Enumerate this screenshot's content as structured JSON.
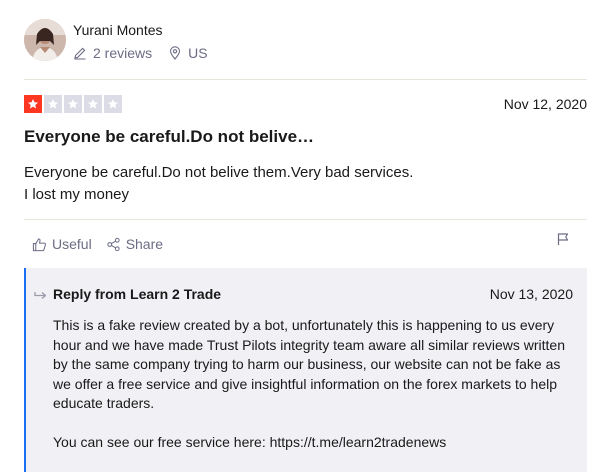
{
  "reviewer": {
    "name": "Yurani Montes",
    "reviews_count": "2 reviews",
    "country": "US"
  },
  "review": {
    "rating": 1,
    "max_rating": 5,
    "date": "Nov 12, 2020",
    "title": "Everyone be careful.Do not belive…",
    "body_lines": [
      "Everyone be careful.Do not belive them.Very bad services.",
      "I lost my money"
    ]
  },
  "actions": {
    "useful_label": "Useful",
    "share_label": "Share"
  },
  "reply": {
    "header": "Reply from Learn 2 Trade",
    "date": "Nov 13, 2020",
    "paragraphs": [
      "This is a fake review created by a bot, unfortunately this is happening to us every hour and we have made Trust Pilots integrity team aware all similar reviews written by the same company trying to harm our business, our website can not be fake as we offer a free service and give insightful information on the forex markets to help educate traders.",
      "You can see our free service here: https://t.me/learn2tradenews"
    ]
  },
  "colors": {
    "star_filled": "#ff3722",
    "star_empty": "#dcdce6",
    "reply_accent": "#1c6ff5",
    "reply_background": "#f1f1f5"
  },
  "icons": {
    "reviews": "pencil-icon",
    "location": "location-pin-icon",
    "useful": "thumbs-up-icon",
    "share": "share-icon",
    "report": "flag-icon",
    "reply": "reply-arrow-icon"
  }
}
